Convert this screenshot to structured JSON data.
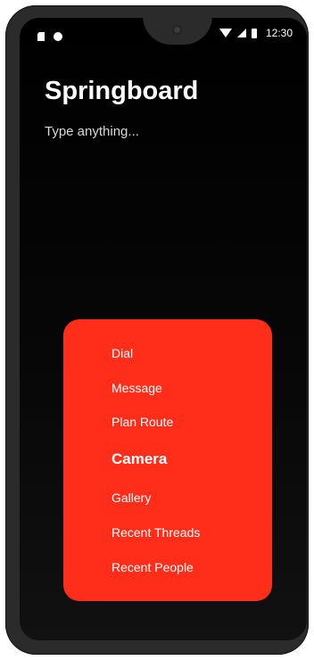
{
  "status_bar": {
    "time": "12:30",
    "icons": [
      "sd-card-icon",
      "notification-dot-icon",
      "wifi-icon",
      "cell-signal-icon",
      "battery-icon"
    ]
  },
  "app": {
    "title": "Springboard"
  },
  "search": {
    "placeholder": "Type anything...",
    "value": ""
  },
  "menu": {
    "items": [
      {
        "label": "Dial"
      },
      {
        "label": "Message"
      },
      {
        "label": "Plan Route"
      },
      {
        "label": "Camera"
      },
      {
        "label": "Gallery"
      },
      {
        "label": "Recent Threads"
      },
      {
        "label": "Recent People"
      }
    ],
    "selected": "Camera"
  },
  "colors": {
    "background": "#000000",
    "menu_card": "#ff2e1b",
    "text": "#ffffff"
  }
}
